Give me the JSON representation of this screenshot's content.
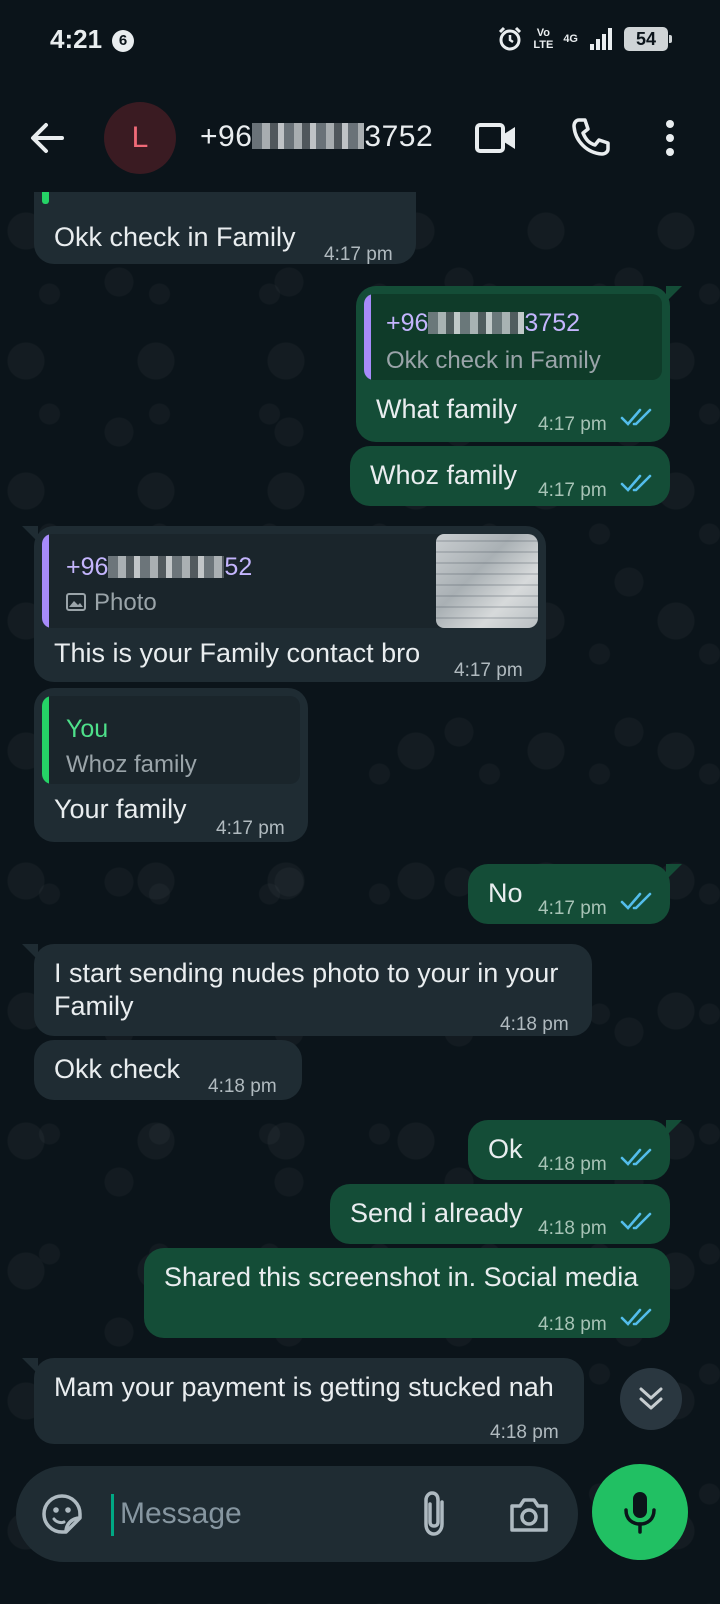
{
  "status_bar": {
    "time": "4:21",
    "notification_count": "6",
    "volte_top": "Vo",
    "volte_bottom": "LTE",
    "network": "4G",
    "battery": "54"
  },
  "header": {
    "avatar_letter": "L",
    "contact_prefix": "+96",
    "contact_suffix": "3752",
    "icons": [
      "back-arrow-icon",
      "video-call-icon",
      "phone-icon",
      "more-vert-icon"
    ]
  },
  "messages": [
    {
      "dir": "in",
      "text": "Okk check in Family",
      "time": "4:17 pm"
    },
    {
      "dir": "out",
      "quote_name_prefix": "+96",
      "quote_name_suffix": "3752",
      "quote_text": "Okk check in Family",
      "text": "What family",
      "time": "4:17 pm"
    },
    {
      "dir": "out",
      "text": "Whoz family",
      "time": "4:17 pm"
    },
    {
      "dir": "in",
      "quote_name_prefix": "+96",
      "quote_name_suffix": "52",
      "quote_text": "Photo",
      "text": "This is your Family contact bro",
      "time": "4:17 pm"
    },
    {
      "dir": "in",
      "quote_name": "You",
      "quote_text": "Whoz family",
      "text": "Your family",
      "time": "4:17 pm"
    },
    {
      "dir": "out",
      "text": "No",
      "time": "4:17 pm"
    },
    {
      "dir": "in",
      "text_line1": "I start sending nudes photo to your in your",
      "text_line2": "Family",
      "time": "4:18 pm"
    },
    {
      "dir": "in",
      "text": "Okk check",
      "time": "4:18 pm"
    },
    {
      "dir": "out",
      "text": "Ok",
      "time": "4:18 pm"
    },
    {
      "dir": "out",
      "text": "Send i already",
      "time": "4:18 pm"
    },
    {
      "dir": "out",
      "text": "Shared this screenshot in.  Social media",
      "time": "4:18 pm"
    },
    {
      "dir": "in",
      "text": "Mam your payment is getting stucked nah",
      "time": "4:18 pm"
    }
  ],
  "composer": {
    "placeholder": "Message"
  },
  "colors": {
    "background": "#0b141a",
    "incoming_bubble": "#1f2c33",
    "outgoing_bubble": "#144d37",
    "accent_green": "#21c063",
    "read_ticks": "#53bdeb",
    "quote_purple": "#a78bfa",
    "quote_green": "#25d366"
  }
}
